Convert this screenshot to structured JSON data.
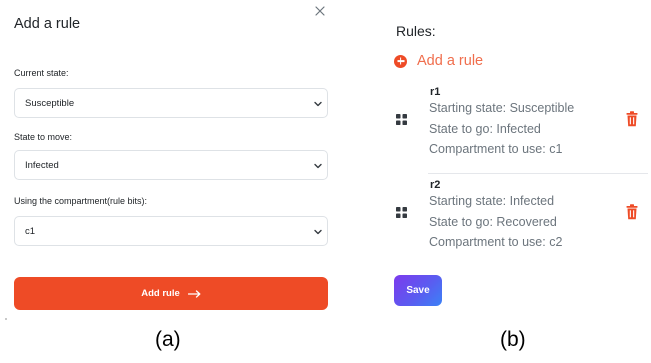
{
  "modal": {
    "title": "Add a rule",
    "close_icon": "close-icon",
    "fields": [
      {
        "label": "Current state:",
        "selected": "Susceptible"
      },
      {
        "label": "State to move:",
        "selected": "Infected"
      },
      {
        "label": "Using the compartment(rule bits):",
        "selected": "c1"
      }
    ],
    "submit_label": "Add rule",
    "submit_icon": "arrow-right-icon",
    "submit_color": "#ee4b26"
  },
  "rules_panel": {
    "heading": "Rules:",
    "add_link_label": "Add a rule",
    "add_icon": "plus-circle-icon",
    "accent_color": "#f06e4d",
    "rules": [
      {
        "name": "r1",
        "starting_state": "Starting state: Susceptible",
        "state_to_go": "State to go: Infected",
        "compartment": "Compartment to use: c1"
      },
      {
        "name": "r2",
        "starting_state": "Starting state: Infected",
        "state_to_go": "State to go: Recovered",
        "compartment": "Compartment to use: c2"
      }
    ],
    "drag_icon": "grip-icon",
    "delete_icon": "trash-icon",
    "save_label": "Save"
  },
  "captions": {
    "a": "(a)",
    "b": "(b)"
  }
}
